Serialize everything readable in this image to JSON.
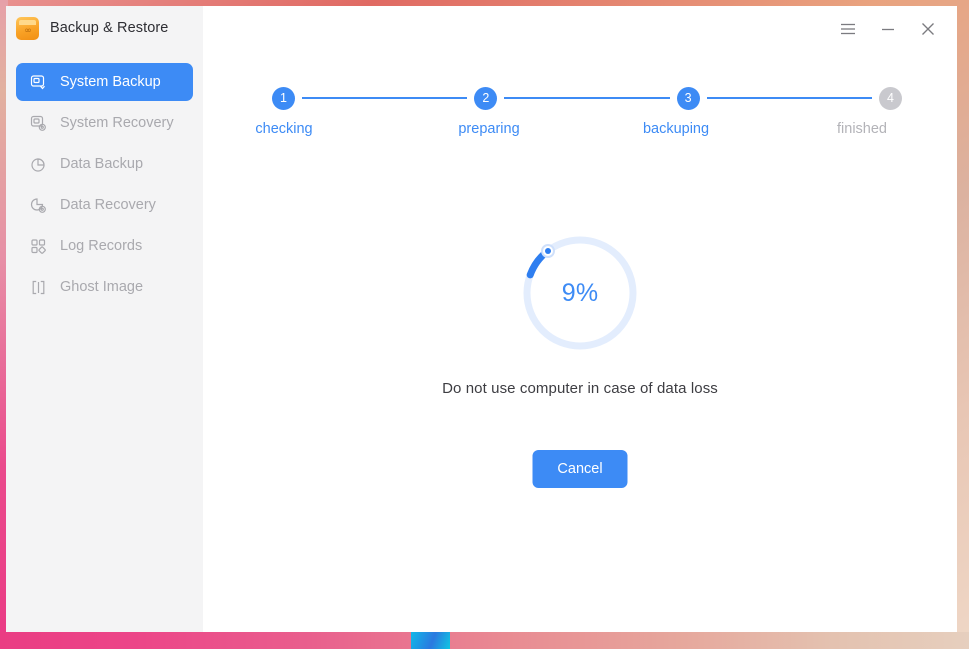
{
  "window": {
    "app_title": "Backup & Restore",
    "app_icon": "backup-box-icon",
    "controls": [
      {
        "name": "menu-button",
        "icon": "hamburger-menu-icon"
      },
      {
        "name": "minimize-button",
        "icon": "minimize-icon"
      },
      {
        "name": "close-button",
        "icon": "close-icon"
      }
    ]
  },
  "sidebar": {
    "items": [
      {
        "label": "System Backup",
        "icon": "system-backup-icon",
        "active": true
      },
      {
        "label": "System Recovery",
        "icon": "system-recovery-icon",
        "active": false
      },
      {
        "label": "Data Backup",
        "icon": "data-backup-icon",
        "active": false
      },
      {
        "label": "Data Recovery",
        "icon": "data-recovery-icon",
        "active": false
      },
      {
        "label": "Log Records",
        "icon": "log-records-icon",
        "active": false
      },
      {
        "label": "Ghost Image",
        "icon": "ghost-image-icon",
        "active": false
      }
    ]
  },
  "stepper": {
    "steps": [
      {
        "number": "1",
        "label": "checking",
        "active": true
      },
      {
        "number": "2",
        "label": "preparing",
        "active": true
      },
      {
        "number": "3",
        "label": "backuping",
        "active": true
      },
      {
        "number": "4",
        "label": "finished",
        "active": false
      }
    ]
  },
  "progress": {
    "percent_label": "9%",
    "percent_value": 9,
    "warning": "Do not use computer in case of data loss"
  },
  "actions": {
    "cancel_label": "Cancel"
  },
  "colors": {
    "accent": "#3d8bf5",
    "inactive": "#c9c9ce",
    "ring_track": "#e3edfd",
    "sidebar_bg": "#f4f4f5",
    "taskbar_start": "#ea3d83",
    "taskbar_end": "#e6cfbe"
  }
}
